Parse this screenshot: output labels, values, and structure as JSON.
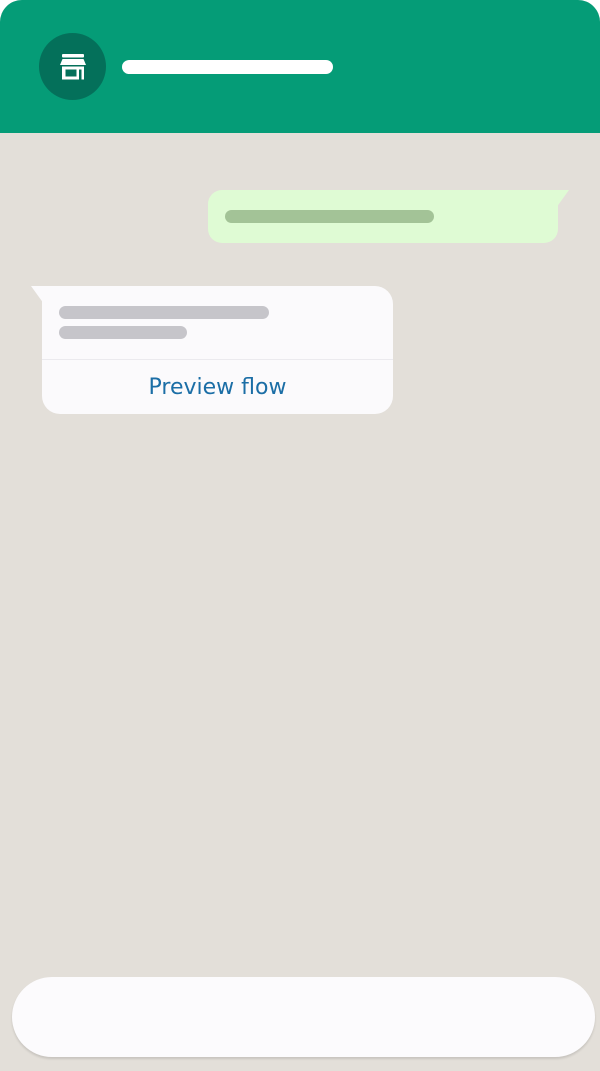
{
  "chat": {
    "received": {
      "action_label": "Preview flow"
    }
  },
  "colors": {
    "header": "#059c77",
    "avatar": "#04705a",
    "chat_background": "#e3dfd9",
    "sent_bubble": "#dffbd4",
    "received_bubble": "#fbfafc",
    "link": "#1b6ea6"
  },
  "icons": {
    "avatar": "storefront-icon"
  }
}
